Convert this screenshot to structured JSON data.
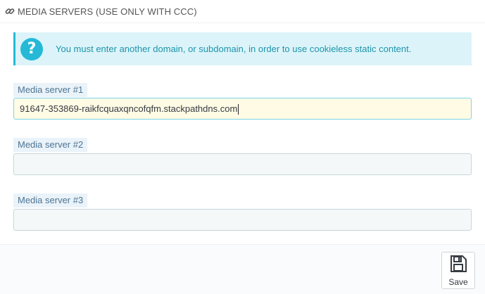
{
  "heading": {
    "title": "MEDIA SERVERS (USE ONLY WITH CCC)",
    "icon": "link-icon"
  },
  "alert": {
    "icon": "question-icon",
    "message": "You must enter another domain, or subdomain, in order to use cookieless static content."
  },
  "fields": [
    {
      "label": "Media server #1",
      "value": "91647-353869-raikfcquaxqncofqfm.stackpathdns.com",
      "placeholder": ""
    },
    {
      "label": "Media server #2",
      "value": "",
      "placeholder": ""
    },
    {
      "label": "Media server #3",
      "value": "",
      "placeholder": ""
    }
  ],
  "footer": {
    "save_label": "Save",
    "save_icon": "floppy-disk-icon"
  },
  "colors": {
    "accent": "#25b9d7",
    "alert_bg": "#dcf4f9",
    "focus_bg": "#fffbe5"
  }
}
